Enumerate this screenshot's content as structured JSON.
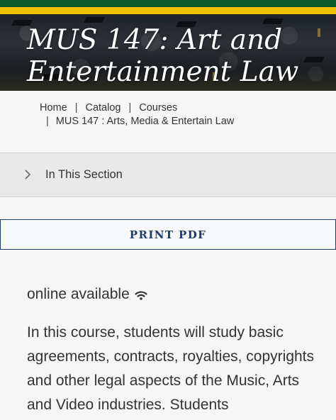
{
  "hero": {
    "title": "MUS 147: Art and Entertainment Law"
  },
  "breadcrumb": {
    "items": [
      "Home",
      "Catalog",
      "Courses",
      "MUS 147 : Arts, Media & Entertain Law"
    ],
    "separator": "|"
  },
  "section_toggle": {
    "label": "In This Section",
    "icon": "chevron-right-icon"
  },
  "print_button": {
    "label": "PRINT PDF"
  },
  "course": {
    "availability": "online available",
    "availability_icon": "wifi-icon",
    "description": "In this course, students will study basic agreements, contracts, royalties, copyrights and other legal aspects of the Music, Arts and Video industries. Students"
  },
  "colors": {
    "brand_green": "#0b5a2c",
    "brand_gold": "#f2c100",
    "button_navy": "#1d3b6b"
  }
}
